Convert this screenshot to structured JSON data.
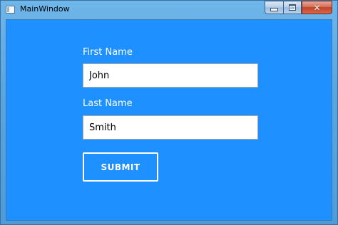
{
  "window": {
    "title": "MainWindow",
    "icon": "app-window-icon",
    "caption_buttons": {
      "minimize_icon": "minimize-icon",
      "maximize_icon": "maximize-icon",
      "close_icon": "close-icon",
      "close_glyph": "✕"
    },
    "colors": {
      "client_background": "#1e90ff",
      "frame": "#5aa6e0",
      "close_button": "#c34329"
    }
  },
  "form": {
    "first_name": {
      "label": "First Name",
      "value": "John"
    },
    "last_name": {
      "label": "Last Name",
      "value": "Smith"
    },
    "submit_label": "SUBMIT"
  }
}
